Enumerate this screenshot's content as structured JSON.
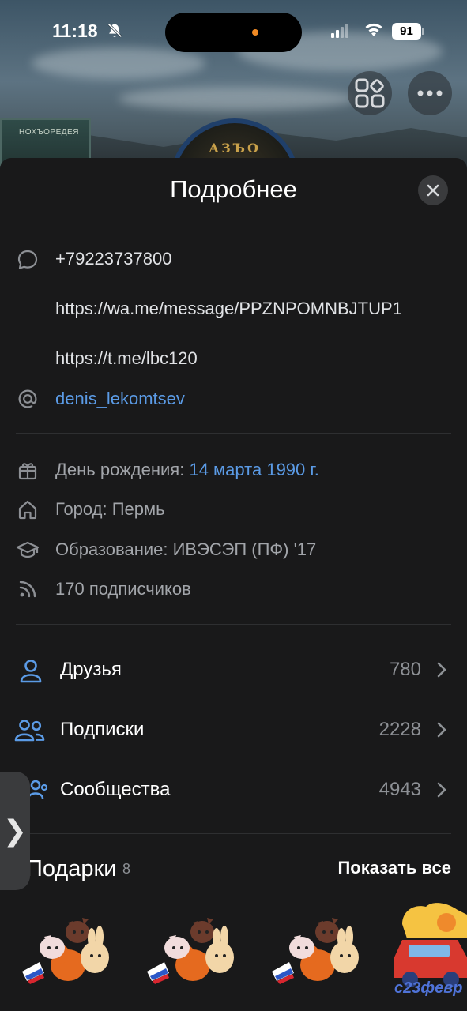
{
  "status_bar": {
    "time": "11:18",
    "battery": "91"
  },
  "header": {
    "avatar_text": "АЗЪО",
    "sign_text": "НОХЪОРЕДЕЯ"
  },
  "sheet": {
    "title": "Подробнее",
    "contacts": {
      "phone": "+79223737800",
      "whatsapp": "https://wa.me/message/PPZNPOMNBJTUP1",
      "telegram": "https://t.me/lbc120",
      "username": "denis_lekomtsev"
    },
    "info": {
      "birthday_label": "День рождения:",
      "birthday_value": "14 марта 1990 г.",
      "city": "Город: Пермь",
      "education": "Образование: ИВЭСЭП (ПФ) '17",
      "followers": "170 подписчиков"
    },
    "nav": [
      {
        "label": "Друзья",
        "count": "780"
      },
      {
        "label": "Подписки",
        "count": "2228"
      },
      {
        "label": "Сообщества",
        "count": "4943"
      }
    ],
    "gifts": {
      "title": "Подарки",
      "count": "8",
      "show_all": "Показать все",
      "holiday_text": "с23февр"
    }
  },
  "icons": {
    "bell": "bell-slash-icon",
    "signal": "signal-icon",
    "wifi": "wifi-icon",
    "apps": "apps-grid-icon",
    "more": "more-dots-icon",
    "close": "close-icon",
    "message": "message-icon",
    "at": "at-sign-icon",
    "gift": "gift-icon",
    "home": "home-icon",
    "education": "graduation-cap-icon",
    "rss": "rss-icon",
    "friend": "user-icon",
    "subscriptions": "users-icon",
    "groups": "community-icon",
    "chevron": "chevron-right-icon",
    "side_tab": "chevron-right-tab-icon"
  },
  "colors": {
    "accent": "#5b9be6",
    "sheet_bg": "#19191a",
    "text": "#e1e3e6",
    "muted": "#a2a5aa"
  }
}
